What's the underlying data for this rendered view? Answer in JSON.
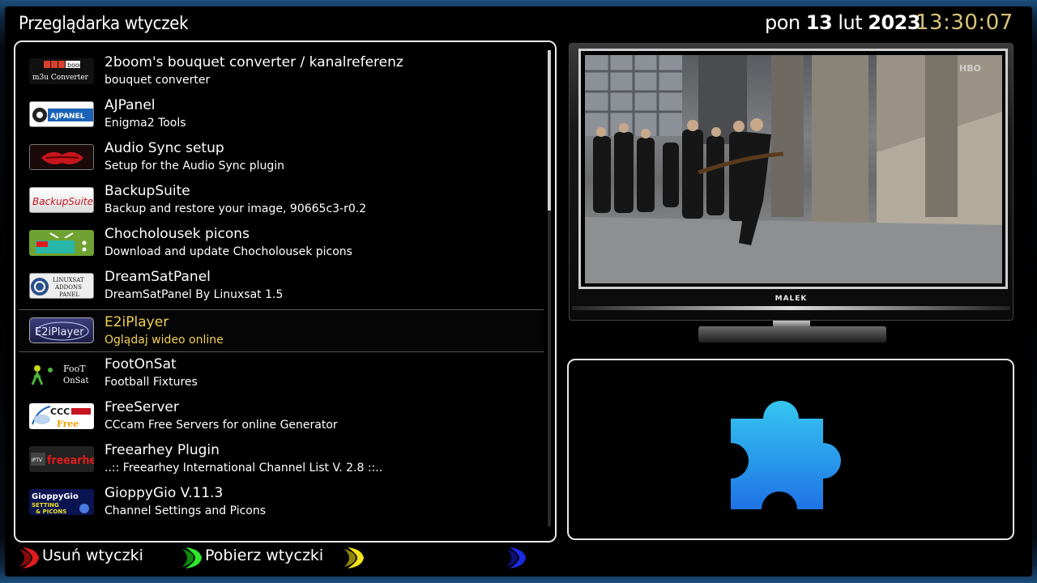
{
  "header": {
    "title": "Przeglądarka wtyczek",
    "date_day": "pon",
    "date_num": "13",
    "date_month": "lut",
    "date_year": "2023",
    "clock": "13:30:07"
  },
  "plugins": [
    {
      "name": "2boom's bouquet converter / kanalreferenz",
      "desc": "bouquet converter",
      "logo": "boom-m3u-icon",
      "logo_text": [
        "boom",
        "m3u Converter"
      ]
    },
    {
      "name": "AJPanel",
      "desc": "Enigma2 Tools",
      "logo": "ajpanel-icon",
      "logo_text": [
        "AJPANEL"
      ]
    },
    {
      "name": "Audio Sync setup",
      "desc": "Setup for the Audio Sync plugin",
      "logo": "lips-icon",
      "logo_text": []
    },
    {
      "name": "BackupSuite",
      "desc": "Backup and restore your image, 90665c3-r0.2",
      "logo": "backupsuite-icon",
      "logo_text": [
        "BackupSuite"
      ]
    },
    {
      "name": "Chocholousek picons",
      "desc": "Download and update Chocholousek picons",
      "logo": "tv-picons-icon",
      "logo_text": []
    },
    {
      "name": "DreamSatPanel",
      "desc": "DreamSatPanel By Linuxsat 1.5",
      "logo": "linuxsat-icon",
      "logo_text": [
        "LINUXSAT",
        "ADDONS",
        "PANEL"
      ]
    },
    {
      "name": "E2iPlayer",
      "desc": "Oglądaj wideo online",
      "logo": "e2iplayer-icon",
      "logo_text": [
        "E2iPlayer"
      ],
      "selected": true
    },
    {
      "name": "FootOnSat",
      "desc": "Football Fixtures",
      "logo": "footonsat-icon",
      "logo_text": [
        "FooT",
        "OnSat"
      ]
    },
    {
      "name": "FreeServer",
      "desc": "CCcam Free Servers for online Generator",
      "logo": "cccam-free-icon",
      "logo_text": [
        "CCC",
        "Free"
      ]
    },
    {
      "name": "Freearhey Plugin",
      "desc": "..:: Freearhey International Channel List V. 2.8 ::..",
      "logo": "freearhey-icon",
      "logo_text": [
        "IPTV",
        "freearhey"
      ]
    },
    {
      "name": "GioppyGio V.11.3",
      "desc": "Channel Settings and Picons",
      "logo": "gioppygio-icon",
      "logo_text": [
        "GioppyGio",
        "SETTING",
        "& PICONS"
      ]
    }
  ],
  "tv": {
    "brand": "MALEK",
    "channel_logo": "HBO"
  },
  "buttons": {
    "red": "Usuń wtyczki",
    "green": "Pobierz wtyczki",
    "yellow": "",
    "blue": ""
  },
  "colors": {
    "selected_text": "#f1d04f",
    "clock": "#d9c27a",
    "red": "#e01b1b",
    "green": "#2ee82e",
    "yellow": "#f3e31a",
    "blue": "#1c2be0",
    "puzzle_top": "#35c6ef",
    "puzzle_bottom": "#1f73e6"
  }
}
